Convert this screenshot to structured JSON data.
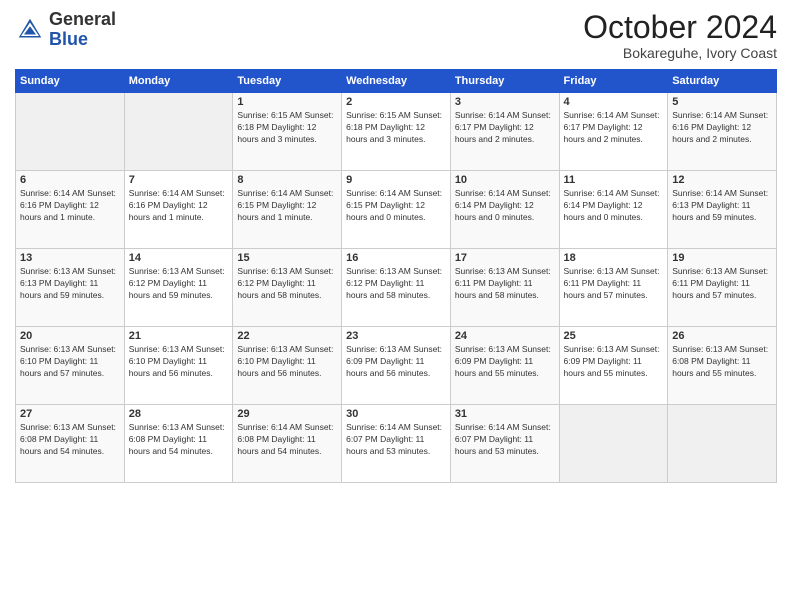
{
  "logo": {
    "general": "General",
    "blue": "Blue"
  },
  "title": "October 2024",
  "subtitle": "Bokareguhe, Ivory Coast",
  "days_header": [
    "Sunday",
    "Monday",
    "Tuesday",
    "Wednesday",
    "Thursday",
    "Friday",
    "Saturday"
  ],
  "weeks": [
    [
      {
        "num": "",
        "info": ""
      },
      {
        "num": "",
        "info": ""
      },
      {
        "num": "1",
        "info": "Sunrise: 6:15 AM\nSunset: 6:18 PM\nDaylight: 12 hours and 3 minutes."
      },
      {
        "num": "2",
        "info": "Sunrise: 6:15 AM\nSunset: 6:18 PM\nDaylight: 12 hours and 3 minutes."
      },
      {
        "num": "3",
        "info": "Sunrise: 6:14 AM\nSunset: 6:17 PM\nDaylight: 12 hours and 2 minutes."
      },
      {
        "num": "4",
        "info": "Sunrise: 6:14 AM\nSunset: 6:17 PM\nDaylight: 12 hours and 2 minutes."
      },
      {
        "num": "5",
        "info": "Sunrise: 6:14 AM\nSunset: 6:16 PM\nDaylight: 12 hours and 2 minutes."
      }
    ],
    [
      {
        "num": "6",
        "info": "Sunrise: 6:14 AM\nSunset: 6:16 PM\nDaylight: 12 hours and 1 minute."
      },
      {
        "num": "7",
        "info": "Sunrise: 6:14 AM\nSunset: 6:16 PM\nDaylight: 12 hours and 1 minute."
      },
      {
        "num": "8",
        "info": "Sunrise: 6:14 AM\nSunset: 6:15 PM\nDaylight: 12 hours and 1 minute."
      },
      {
        "num": "9",
        "info": "Sunrise: 6:14 AM\nSunset: 6:15 PM\nDaylight: 12 hours and 0 minutes."
      },
      {
        "num": "10",
        "info": "Sunrise: 6:14 AM\nSunset: 6:14 PM\nDaylight: 12 hours and 0 minutes."
      },
      {
        "num": "11",
        "info": "Sunrise: 6:14 AM\nSunset: 6:14 PM\nDaylight: 12 hours and 0 minutes."
      },
      {
        "num": "12",
        "info": "Sunrise: 6:14 AM\nSunset: 6:13 PM\nDaylight: 11 hours and 59 minutes."
      }
    ],
    [
      {
        "num": "13",
        "info": "Sunrise: 6:13 AM\nSunset: 6:13 PM\nDaylight: 11 hours and 59 minutes."
      },
      {
        "num": "14",
        "info": "Sunrise: 6:13 AM\nSunset: 6:12 PM\nDaylight: 11 hours and 59 minutes."
      },
      {
        "num": "15",
        "info": "Sunrise: 6:13 AM\nSunset: 6:12 PM\nDaylight: 11 hours and 58 minutes."
      },
      {
        "num": "16",
        "info": "Sunrise: 6:13 AM\nSunset: 6:12 PM\nDaylight: 11 hours and 58 minutes."
      },
      {
        "num": "17",
        "info": "Sunrise: 6:13 AM\nSunset: 6:11 PM\nDaylight: 11 hours and 58 minutes."
      },
      {
        "num": "18",
        "info": "Sunrise: 6:13 AM\nSunset: 6:11 PM\nDaylight: 11 hours and 57 minutes."
      },
      {
        "num": "19",
        "info": "Sunrise: 6:13 AM\nSunset: 6:11 PM\nDaylight: 11 hours and 57 minutes."
      }
    ],
    [
      {
        "num": "20",
        "info": "Sunrise: 6:13 AM\nSunset: 6:10 PM\nDaylight: 11 hours and 57 minutes."
      },
      {
        "num": "21",
        "info": "Sunrise: 6:13 AM\nSunset: 6:10 PM\nDaylight: 11 hours and 56 minutes."
      },
      {
        "num": "22",
        "info": "Sunrise: 6:13 AM\nSunset: 6:10 PM\nDaylight: 11 hours and 56 minutes."
      },
      {
        "num": "23",
        "info": "Sunrise: 6:13 AM\nSunset: 6:09 PM\nDaylight: 11 hours and 56 minutes."
      },
      {
        "num": "24",
        "info": "Sunrise: 6:13 AM\nSunset: 6:09 PM\nDaylight: 11 hours and 55 minutes."
      },
      {
        "num": "25",
        "info": "Sunrise: 6:13 AM\nSunset: 6:09 PM\nDaylight: 11 hours and 55 minutes."
      },
      {
        "num": "26",
        "info": "Sunrise: 6:13 AM\nSunset: 6:08 PM\nDaylight: 11 hours and 55 minutes."
      }
    ],
    [
      {
        "num": "27",
        "info": "Sunrise: 6:13 AM\nSunset: 6:08 PM\nDaylight: 11 hours and 54 minutes."
      },
      {
        "num": "28",
        "info": "Sunrise: 6:13 AM\nSunset: 6:08 PM\nDaylight: 11 hours and 54 minutes."
      },
      {
        "num": "29",
        "info": "Sunrise: 6:14 AM\nSunset: 6:08 PM\nDaylight: 11 hours and 54 minutes."
      },
      {
        "num": "30",
        "info": "Sunrise: 6:14 AM\nSunset: 6:07 PM\nDaylight: 11 hours and 53 minutes."
      },
      {
        "num": "31",
        "info": "Sunrise: 6:14 AM\nSunset: 6:07 PM\nDaylight: 11 hours and 53 minutes."
      },
      {
        "num": "",
        "info": ""
      },
      {
        "num": "",
        "info": ""
      }
    ]
  ]
}
